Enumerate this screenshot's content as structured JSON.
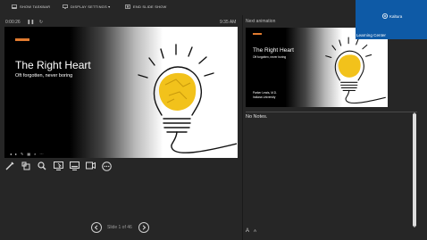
{
  "top_menu": {
    "show_taskbar": "SHOW TASKBAR",
    "display_settings": "DISPLAY SETTINGS ▾",
    "end_slide_show": "END SLIDE SHOW"
  },
  "timer": "0:00:26",
  "clock": "9:35 AM",
  "current_slide": {
    "title": "The Right Heart",
    "subtitle": "Oft forgotten, never boring"
  },
  "next_panel": {
    "label": "Next animation",
    "title": "The Right Heart",
    "subtitle": "Oft forgotten, never boring",
    "presenter_name": "Parker Lewis, M.D.",
    "presenter_org": "Indiana University"
  },
  "brand_panel": {
    "logo_text": "Kaltura",
    "caption": "Learning Center"
  },
  "notes_text": "No Notes.",
  "slide_counter": "Slide 1 of 46",
  "font_increase": "A",
  "font_decrease": "A",
  "colors": {
    "background": "#262626",
    "accent_orange": "#e07a2f",
    "brand_blue": "#0e5aa6",
    "bulb_yellow": "#f2c21b"
  },
  "icons": {
    "toolbar": [
      "pen-tool-icon",
      "all-slides-icon",
      "zoom-icon",
      "pointer-icon",
      "black-screen-icon",
      "subtitles-icon",
      "more-options-icon"
    ]
  }
}
